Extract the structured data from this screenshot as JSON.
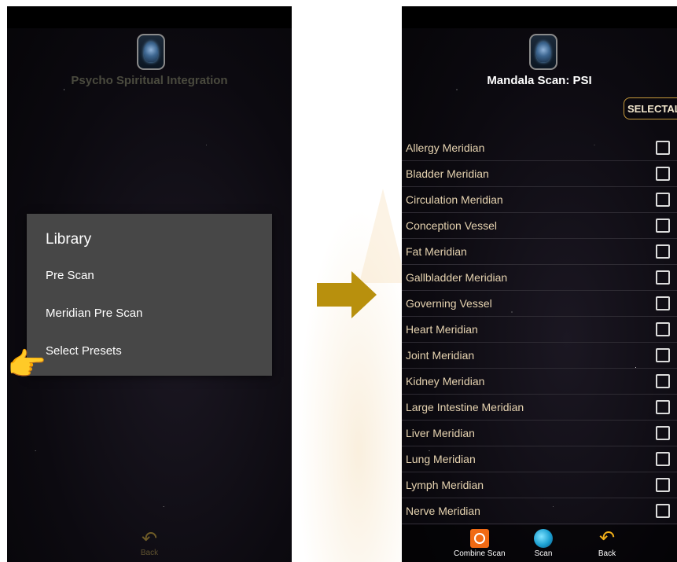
{
  "left_screen": {
    "title": "Psycho Spiritual Integration",
    "dialog": {
      "title": "Library",
      "items": [
        "Pre Scan",
        "Meridian Pre Scan",
        "Select Presets"
      ]
    },
    "back_label": "Back"
  },
  "right_screen": {
    "title": "Mandala Scan: PSI",
    "select_all_label": "SELECTALL",
    "meridians": [
      "Allergy Meridian",
      "Bladder Meridian",
      "Circulation Meridian",
      "Conception Vessel",
      "Fat Meridian",
      "Gallbladder Meridian",
      "Governing Vessel",
      "Heart Meridian",
      "Joint Meridian",
      "Kidney Meridian",
      "Large Intestine Meridian",
      "Liver Meridian",
      "Lung Meridian",
      "Lymph Meridian",
      "Nerve Meridian"
    ],
    "bottom_bar": {
      "combine_scan": "Combine Scan",
      "scan": "Scan",
      "back": "Back"
    }
  },
  "colors": {
    "accent_arrow": "#b8900d",
    "list_text": "#e6d3b0",
    "dialog_bg": "#474747",
    "combine_icon": "#f06a14",
    "back_icon": "#f2b019"
  },
  "icons": [
    "app-logo-icon",
    "pointing-hand-icon",
    "back-arrow-icon",
    "combine-scan-icon",
    "scan-icon",
    "checkbox-icon",
    "right-arrow-icon"
  ]
}
